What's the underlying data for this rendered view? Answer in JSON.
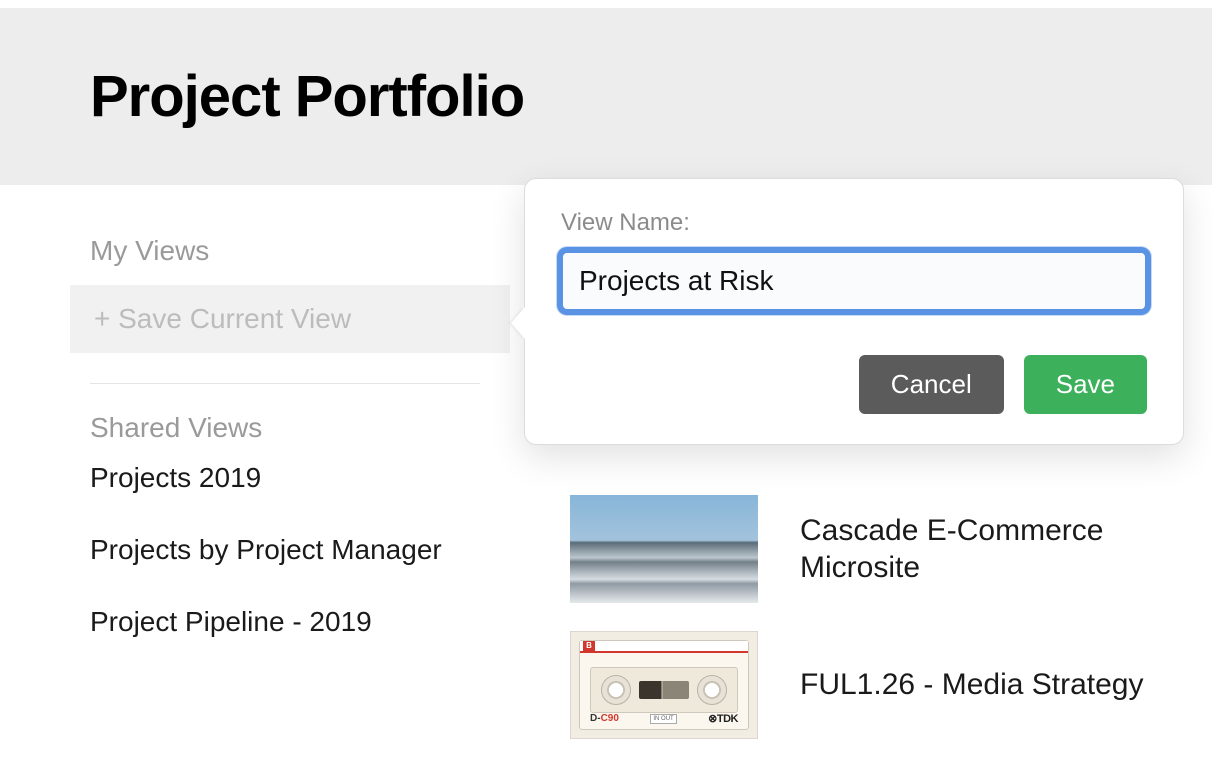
{
  "header": {
    "title": "Project Portfolio"
  },
  "sidebar": {
    "my_views_heading": "My Views",
    "save_current_view": "+ Save Current View",
    "shared_views_heading": "Shared Views",
    "shared_views": [
      {
        "label": "Projects 2019"
      },
      {
        "label": "Projects by Project Manager"
      },
      {
        "label": "Project Pipeline - 2019"
      }
    ]
  },
  "projects": [
    {
      "title": "Cascade E-Commerce Microsite",
      "thumb": "mountain"
    },
    {
      "title": "FUL1.26 - Media Strategy",
      "thumb": "cassette"
    }
  ],
  "cassette": {
    "brand_b": "B",
    "dc90_d": "D-",
    "dc90_c": "C90",
    "tdk": "⊗TDK",
    "inout": "IN OUT"
  },
  "popover": {
    "label": "View Name:",
    "input_value": "Projects at Risk",
    "cancel": "Cancel",
    "save": "Save"
  }
}
